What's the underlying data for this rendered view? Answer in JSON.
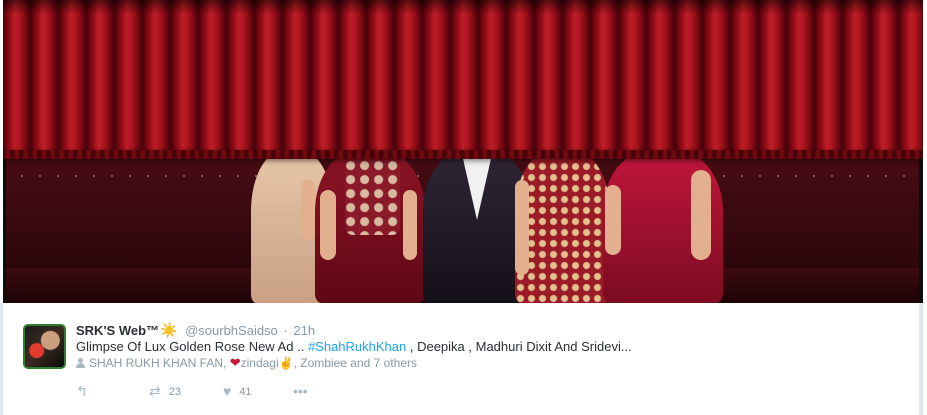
{
  "tweet": {
    "author_name": "SRK'S Web™",
    "author_emoji": "☀️",
    "handle": "@sourbhSaidso",
    "separator": "·",
    "time": "21h",
    "text_part1": "Glimpse Of Lux Golden Rose New Ad .. ",
    "hashtag": "#ShahRukhKhan",
    "text_part2": " , Deepika , Madhuri Dixit And Sridevi...",
    "context_part1": "SHAH RUKH KHAN FAN, ",
    "context_heart": "❤",
    "context_part2": "zindagi",
    "context_hand": "✌",
    "context_part3": ", Zombiee and 7 others",
    "reply_icon": "reply-arrow-icon",
    "retweet_icon": "retweet-icon",
    "retweet_count": "23",
    "like_icon": "heart-icon",
    "like_count": "41",
    "more_icon": "more-dots-icon"
  },
  "colors": {
    "link": "#1da1f2",
    "muted": "#8899a6",
    "text": "#292f33",
    "curtain": "#a3121c"
  }
}
